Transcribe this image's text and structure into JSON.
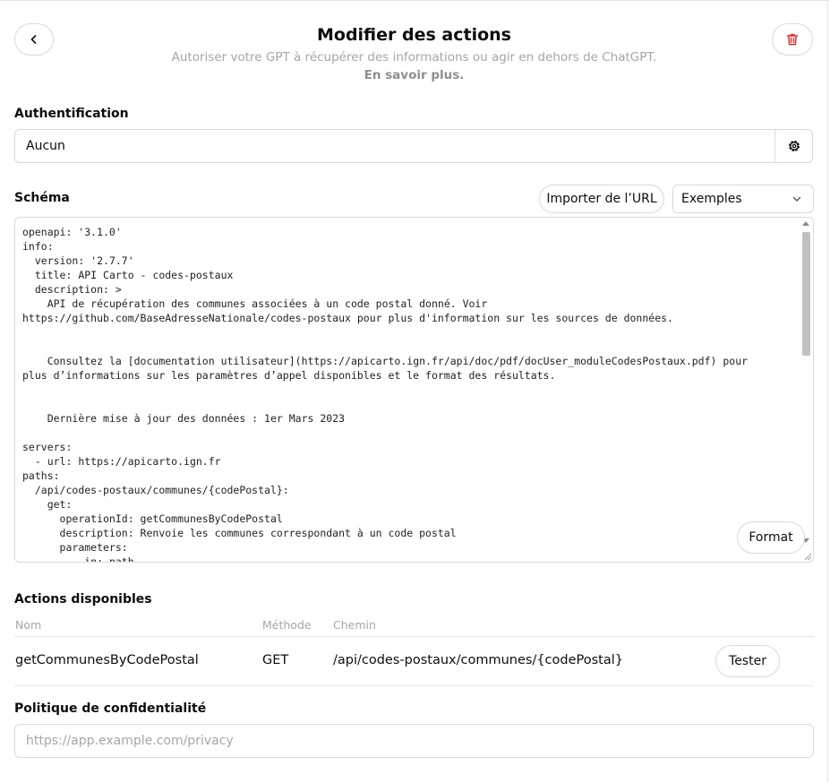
{
  "header": {
    "title": "Modifier des actions",
    "subtitle": "Autoriser votre GPT à récupérer des informations ou agir en dehors de ChatGPT.",
    "learn_more": "En savoir plus."
  },
  "auth": {
    "label": "Authentification",
    "value": "Aucun"
  },
  "schema": {
    "label": "Schéma",
    "import_label": "Importer de l’URL",
    "examples_label": "Exemples",
    "format_label": "Format",
    "code": "openapi: '3.1.0'\ninfo:\n  version: '2.7.7'\n  title: API Carto - codes-postaux\n  description: >\n    API de récupération des communes associées à un code postal donné. Voir\nhttps://github.com/BaseAdresseNationale/codes-postaux pour plus d'information sur les sources de données.\n\n\n    Consultez la [documentation utilisateur](https://apicarto.ign.fr/api/doc/pdf/docUser_moduleCodesPostaux.pdf) pour\nplus d’informations sur les paramètres d’appel disponibles et le format des résultats.\n\n\n    Dernière mise à jour des données : 1er Mars 2023\n\nservers:\n  - url: https://apicarto.ign.fr\npaths:\n  /api/codes-postaux/communes/{codePostal}:\n    get:\n      operationId: getCommunesByCodePostal\n      description: Renvoie les communes correspondant à un code postal\n      parameters:\n        - in: path"
  },
  "actions": {
    "label": "Actions disponibles",
    "columns": {
      "name": "Nom",
      "method": "Méthode",
      "path": "Chemin"
    },
    "rows": [
      {
        "name": "getCommunesByCodePostal",
        "method": "GET",
        "path": "/api/codes-postaux/communes/{codePostal}",
        "test_label": "Tester"
      }
    ]
  },
  "privacy": {
    "label": "Politique de confidentialité",
    "placeholder": "https://app.example.com/privacy",
    "value": ""
  },
  "icons": {
    "back": "chevron-left-icon",
    "delete": "trash-icon",
    "settings": "gear-icon",
    "dropdown": "chevron-down-icon"
  },
  "colors": {
    "danger": "#e02e2a",
    "muted_text": "#a6a6a6",
    "border": "#d9d9d9"
  }
}
